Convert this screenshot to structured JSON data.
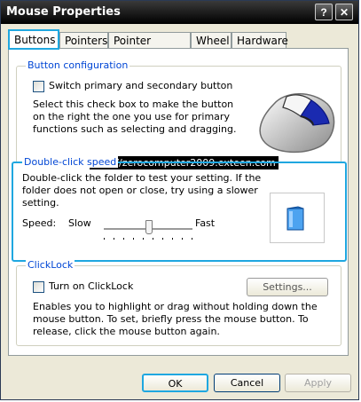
{
  "window": {
    "title": "Mouse Properties",
    "help_glyph": "?",
    "close_glyph": "✕"
  },
  "tabs": [
    {
      "label": "Buttons",
      "active": true
    },
    {
      "label": "Pointers"
    },
    {
      "label": "Pointer Options"
    },
    {
      "label": "Wheel"
    },
    {
      "label": "Hardware"
    }
  ],
  "button_configuration": {
    "legend": "Button configuration",
    "checkbox_label": "Switch primary and secondary button",
    "checkbox_checked": false,
    "description": "Select this check box to make the button on the right the one you use for primary functions such as selecting and dragging.",
    "image_icon": "mouse-icon"
  },
  "watermark": "http://zerocomputer2009.exteen.com",
  "double_click": {
    "legend": "Double-click speed",
    "description": "Double-click the folder to test your setting. If the folder does not open or close, try using a slower setting.",
    "speed_label": "Speed:",
    "slow_label": "Slow",
    "fast_label": "Fast",
    "slider_value": 0.6,
    "folder_icon": "folder-icon"
  },
  "clicklock": {
    "legend": "ClickLock",
    "checkbox_label": "Turn on ClickLock",
    "checkbox_checked": false,
    "settings_button": "Settings...",
    "description": "Enables you to highlight or drag without holding down the mouse button. To set, briefly press the mouse button. To release, click the mouse button again."
  },
  "footer": {
    "ok": "OK",
    "cancel": "Cancel",
    "apply": "Apply"
  }
}
